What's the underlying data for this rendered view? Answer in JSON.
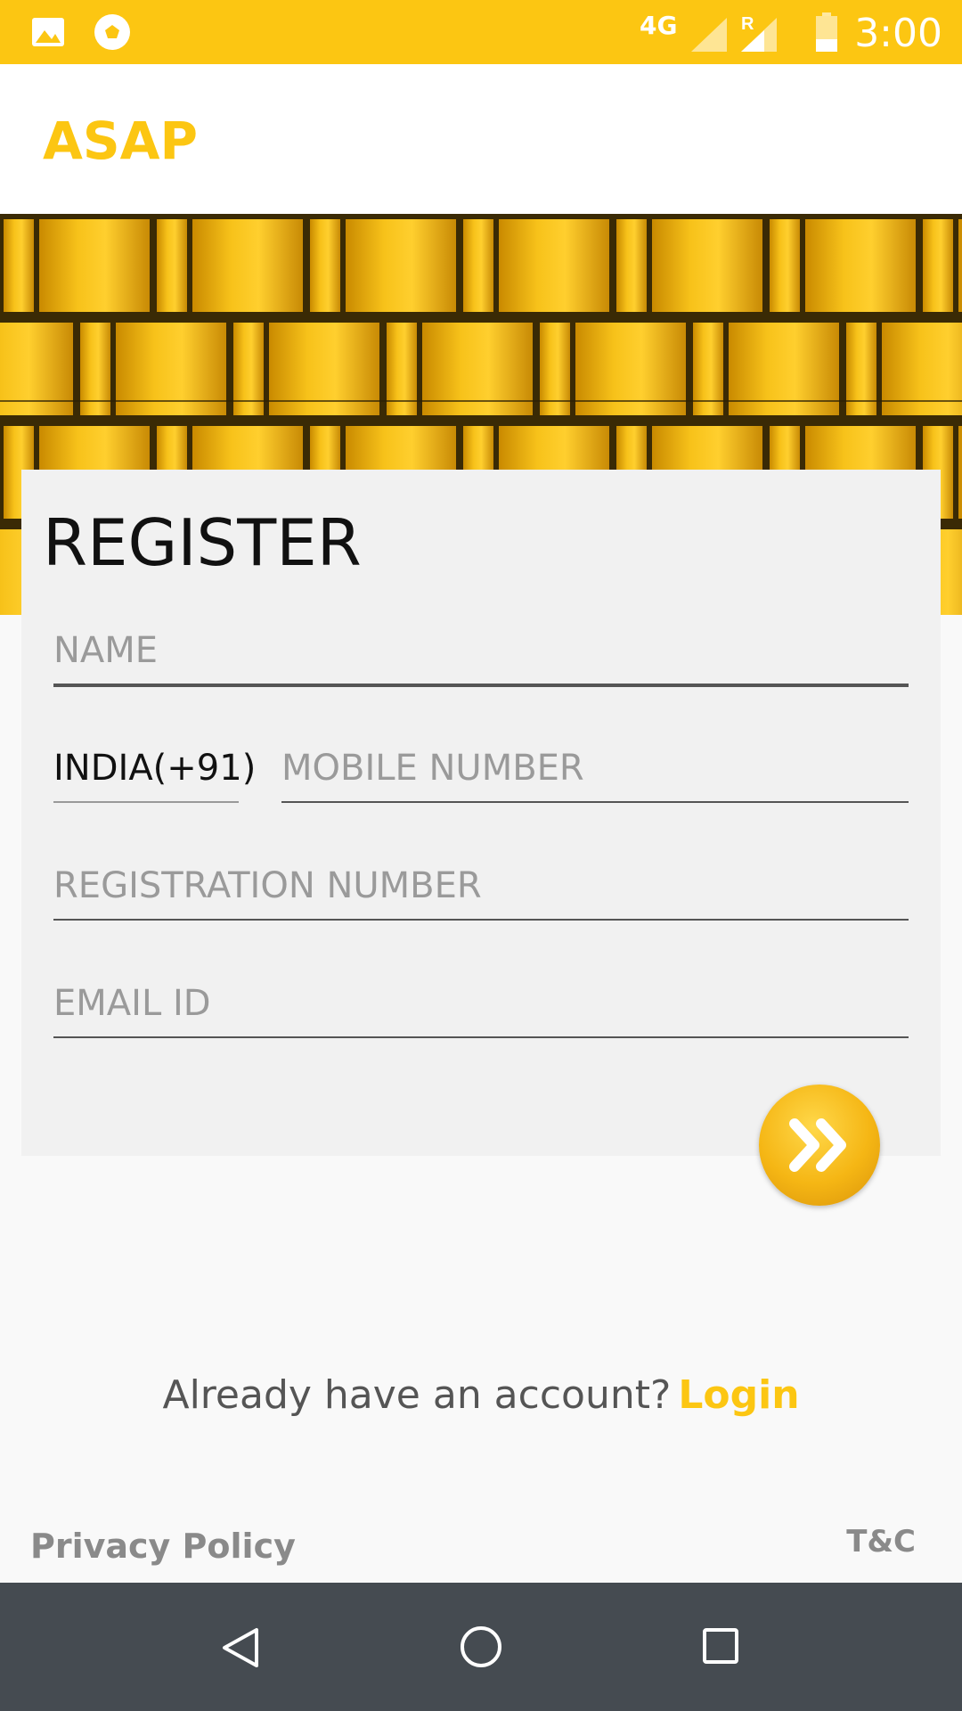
{
  "status_bar": {
    "time": "3:00",
    "network": "4G",
    "roaming": "R",
    "icons": [
      "image-icon",
      "soccer-ball-icon",
      "signal-icon",
      "roaming-signal-icon",
      "battery-icon"
    ]
  },
  "app_bar": {
    "title": "ASAP"
  },
  "register": {
    "title": "REGISTER",
    "name_placeholder": "NAME",
    "country_code": "INDIA(+91)",
    "mobile_placeholder": "MOBILE NUMBER",
    "registration_placeholder": "REGISTRATION NUMBER",
    "email_placeholder": "EMAIL ID"
  },
  "footer": {
    "account_prompt": "Already have an account?",
    "login_label": "Login",
    "privacy_label": "Privacy Policy",
    "tnc_label": "T&C"
  },
  "colors": {
    "accent": "#fcc612",
    "navbar": "#454b51",
    "card": "#f1f1f1",
    "background": "#f9f9f9"
  }
}
